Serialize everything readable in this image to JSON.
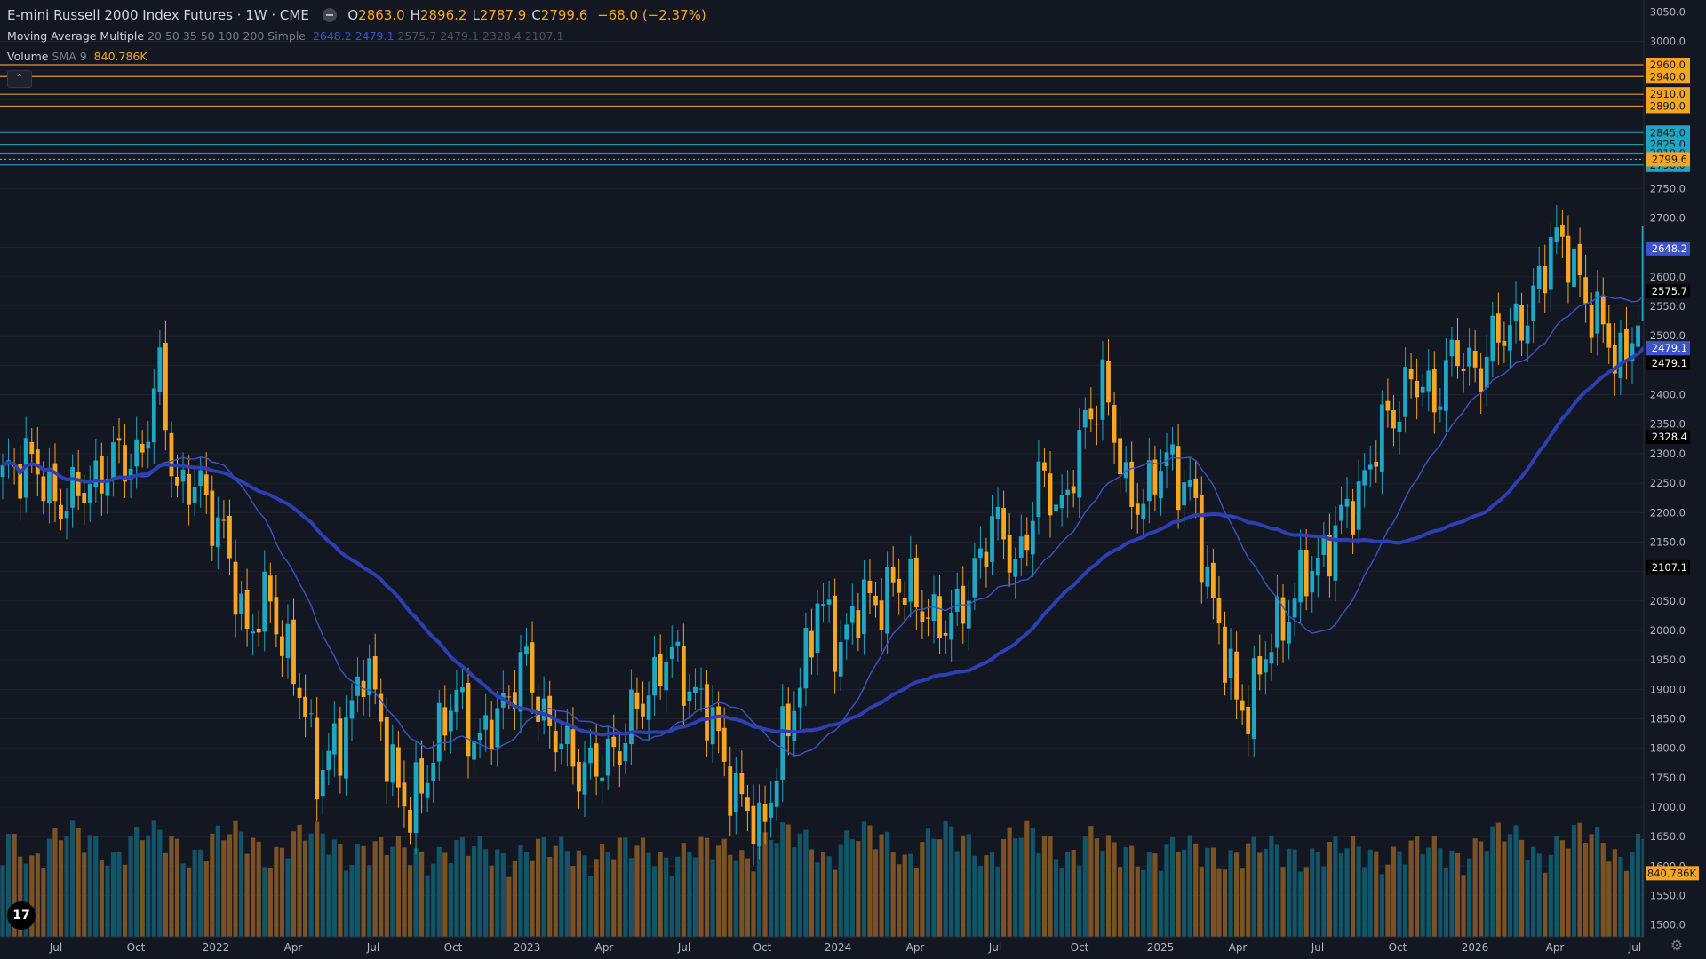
{
  "header": {
    "symbol_title": "E-mini Russell 2000 Index Futures · 1W · CME",
    "ohlc": [
      {
        "k": "O",
        "v": "2863.0"
      },
      {
        "k": "H",
        "v": "2896.2"
      },
      {
        "k": "L",
        "v": "2787.9"
      },
      {
        "k": "C",
        "v": "2799.6"
      }
    ],
    "change": "−68.0 (−2.37%)"
  },
  "indicators": {
    "ma": {
      "name": "Moving Average Multiple",
      "params": "20 50 35 50 100 200 Simple",
      "values": [
        "2648.2",
        "2479.1",
        "2575.7",
        "2479.1",
        "2328.4",
        "2107.1"
      ]
    },
    "volume": {
      "name": "Volume",
      "params": "SMA 9",
      "value": "840.786K"
    }
  },
  "icons": {
    "visibility": "eye-icon",
    "collapse": "chevron-up-icon",
    "logo": "tradingview-logo",
    "settings": "gear-icon"
  },
  "colors": {
    "background": "#131722",
    "up": "#1fa6c2",
    "down": "#f6a623",
    "ma_thin": "#3c54c6",
    "ma_thick": "#2e3fb3",
    "volume_up": "#125468",
    "volume_down": "#7a5224",
    "grid": "#1e2230",
    "axis_text": "#b2b5be"
  },
  "chart_data": {
    "type": "candlestick",
    "timeframe": "1W",
    "y_range": [
      1480,
      3070
    ],
    "price_axis_ticks": [
      1500,
      1550,
      1600,
      1650,
      1700,
      1750,
      1800,
      1850,
      1900,
      1950,
      2000,
      2050,
      2100,
      2150,
      2200,
      2250,
      2300,
      2350,
      2400,
      2450,
      2500,
      2550,
      2600,
      2650,
      2700,
      2750,
      2800,
      2850,
      2900,
      2950,
      3000,
      3050
    ],
    "x_labels": [
      "Jul",
      "Oct",
      "2022",
      "Apr",
      "Jul",
      "Oct",
      "2023",
      "Apr",
      "Jul",
      "Oct",
      "2024",
      "Apr",
      "Jul",
      "Oct",
      "2025",
      "Apr",
      "Jul",
      "Oct",
      "2026",
      "Apr",
      "Jul"
    ],
    "price_path_waypoints": [
      [
        0,
        2250
      ],
      [
        4,
        2300
      ],
      [
        8,
        2230
      ],
      [
        12,
        2220
      ],
      [
        16,
        2260
      ],
      [
        20,
        2290
      ],
      [
        24,
        2300
      ],
      [
        27,
        2440
      ],
      [
        30,
        2230
      ],
      [
        34,
        2250
      ],
      [
        38,
        2150
      ],
      [
        42,
        2000
      ],
      [
        46,
        2050
      ],
      [
        50,
        1930
      ],
      [
        54,
        1770
      ],
      [
        58,
        1800
      ],
      [
        62,
        1950
      ],
      [
        66,
        1800
      ],
      [
        70,
        1680
      ],
      [
        74,
        1800
      ],
      [
        78,
        1890
      ],
      [
        82,
        1800
      ],
      [
        86,
        1880
      ],
      [
        90,
        1940
      ],
      [
        94,
        1830
      ],
      [
        98,
        1780
      ],
      [
        102,
        1760
      ],
      [
        106,
        1810
      ],
      [
        110,
        1880
      ],
      [
        114,
        1960
      ],
      [
        118,
        1910
      ],
      [
        122,
        1840
      ],
      [
        126,
        1720
      ],
      [
        130,
        1660
      ],
      [
        134,
        1800
      ],
      [
        137,
        1920
      ],
      [
        140,
        2040
      ],
      [
        144,
        1980
      ],
      [
        148,
        2050
      ],
      [
        152,
        2060
      ],
      [
        156,
        2080
      ],
      [
        160,
        2000
      ],
      [
        164,
        2040
      ],
      [
        166,
        2050
      ],
      [
        170,
        2200
      ],
      [
        174,
        2100
      ],
      [
        178,
        2250
      ],
      [
        182,
        2210
      ],
      [
        186,
        2340
      ],
      [
        189,
        2430
      ],
      [
        193,
        2230
      ],
      [
        197,
        2230
      ],
      [
        200,
        2300
      ],
      [
        204,
        2230
      ],
      [
        208,
        2050
      ],
      [
        212,
        1870
      ],
      [
        214,
        1880
      ],
      [
        218,
        1980
      ],
      [
        222,
        2060
      ],
      [
        226,
        2120
      ],
      [
        230,
        2180
      ],
      [
        234,
        2260
      ],
      [
        238,
        2360
      ],
      [
        242,
        2420
      ],
      [
        246,
        2400
      ],
      [
        250,
        2470
      ],
      [
        254,
        2440
      ],
      [
        258,
        2520
      ],
      [
        262,
        2520
      ],
      [
        266,
        2670
      ],
      [
        270,
        2620
      ],
      [
        274,
        2520
      ],
      [
        278,
        2460
      ],
      [
        281,
        2520
      ],
      [
        284,
        2820
      ],
      [
        287,
        2810
      ],
      [
        288,
        2800
      ]
    ],
    "ma_series": [
      {
        "name": "20",
        "values": [
          2648.2
        ]
      },
      {
        "name": "50",
        "values": [
          2479.1
        ]
      }
    ],
    "volume_sma_9": "840.786K",
    "horizontal_levels": [
      {
        "price": 2960.0,
        "label": "2960.0",
        "color": "#f6a623"
      },
      {
        "price": 2940.0,
        "label": "2940.0",
        "color": "#f6a623"
      },
      {
        "price": 2910.0,
        "label": "2910.0",
        "color": "#f6a623"
      },
      {
        "price": 2890.0,
        "label": "2890.0",
        "color": "#f6a623"
      },
      {
        "price": 2845.0,
        "label": "2845.0",
        "color": "#1fa6c2"
      },
      {
        "price": 2825.0,
        "label": "2825.0",
        "color": "#1fa6c2"
      },
      {
        "price": 2810.0,
        "label": "2810.0",
        "color": "#1fa6c2"
      },
      {
        "price": 2790.0,
        "label": "2790.0",
        "color": "#1fa6c2"
      }
    ],
    "axis_tags": [
      {
        "price": 2799.6,
        "label": "2799.6",
        "bg": "#f6a623",
        "fg": "#131722"
      },
      {
        "price": 2648.2,
        "label": "2648.2",
        "bg": "#3c54c6",
        "fg": "#ffffff"
      },
      {
        "price": 2575.7,
        "label": "2575.7",
        "bg": "#000000",
        "fg": "#ffffff"
      },
      {
        "price": 2479.1,
        "label": "2479.1",
        "bg": "#3c54c6",
        "fg": "#ffffff"
      },
      {
        "price": 2479.1,
        "label": "2479.1",
        "bg": "#000000",
        "fg": "#ffffff",
        "offset": 1
      },
      {
        "price": 2328.4,
        "label": "2328.4",
        "bg": "#000000",
        "fg": "#ffffff"
      },
      {
        "price": 2107.1,
        "label": "2107.1",
        "bg": "#000000",
        "fg": "#ffffff"
      },
      {
        "price": 1588,
        "label": "840.786K",
        "bg": "#f6a623",
        "fg": "#131722"
      }
    ]
  }
}
